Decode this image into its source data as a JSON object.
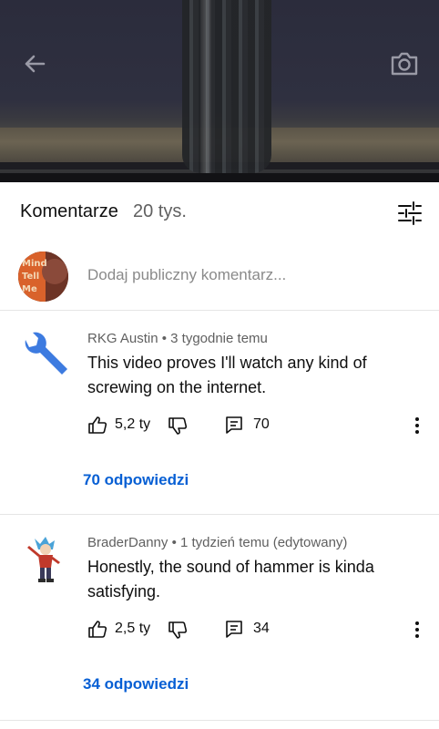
{
  "video": {
    "back_icon": "arrow-left-icon",
    "camera_icon": "camera-icon"
  },
  "header": {
    "title": "Komentarze",
    "count": "20 tys.",
    "filter_icon": "sliders-icon"
  },
  "add_comment": {
    "placeholder": "Dodaj publiczny komentarz...",
    "avatar_text": "Mind Tell Me"
  },
  "comments": [
    {
      "author": "RKG Austin",
      "time": "3 tygodnie temu",
      "text": "This video proves I'll watch any kind of screwing on the internet.",
      "likes": "5,2 ty",
      "reply_count": "70",
      "replies_label": "70 odpowiedzi"
    },
    {
      "author": "BraderDanny",
      "time": "1 tydzień temu (edytowany)",
      "text": "Honestly, the sound of hammer is kinda satisfying.",
      "likes": "2,5 ty",
      "reply_count": "34",
      "replies_label": "34 odpowiedzi"
    }
  ],
  "colors": {
    "link": "#065fd4",
    "muted": "#606060",
    "divider": "#e5e5e5",
    "wrench": "#3d7be0"
  }
}
